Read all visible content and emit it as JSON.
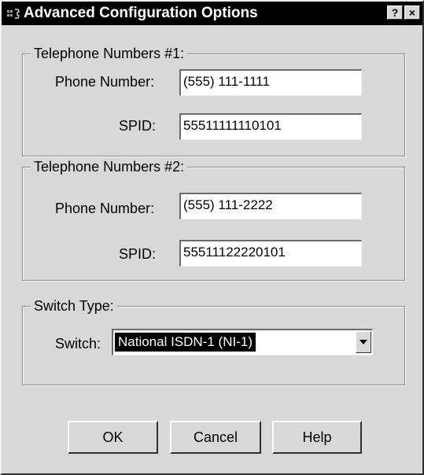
{
  "window": {
    "title": "Advanced Configuration Options",
    "help_glyph": "?",
    "close_glyph": "×"
  },
  "group1": {
    "legend": "Telephone Numbers #1:",
    "phone_label": "Phone Number:",
    "phone_value": "(555) 111-1111",
    "spid_label": "SPID:",
    "spid_value": "55511111110101"
  },
  "group2": {
    "legend": "Telephone Numbers #2:",
    "phone_label": "Phone Number:",
    "phone_value": "(555) 111-2222",
    "spid_label": "SPID:",
    "spid_value": "55511122220101"
  },
  "switch_group": {
    "legend": "Switch Type:",
    "switch_label": "Switch:",
    "switch_value": "National ISDN-1 (NI-1)"
  },
  "buttons": {
    "ok": "OK",
    "cancel": "Cancel",
    "help": "Help"
  },
  "icons": {
    "title": "phone-app-icon",
    "dropdown": "down-arrow-icon"
  }
}
